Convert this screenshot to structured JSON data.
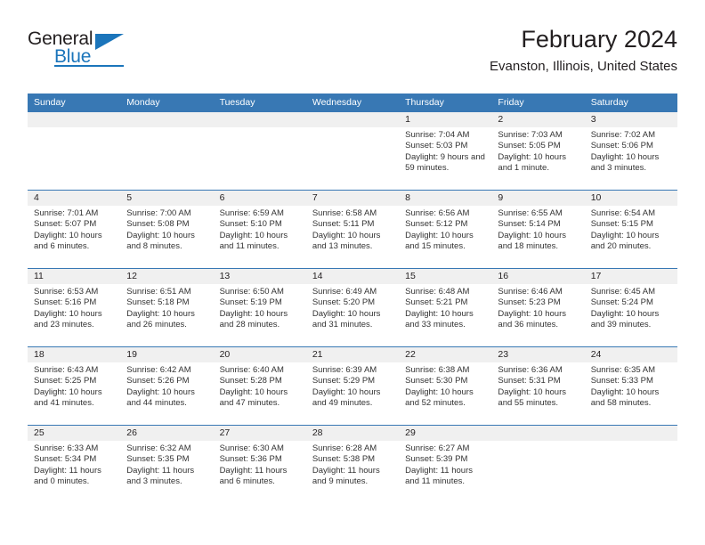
{
  "brand": {
    "name_part1": "General",
    "name_part2": "Blue",
    "logo_icon": "triangle-logo",
    "accent_color": "#1b75bb"
  },
  "header": {
    "title": "February 2024",
    "location": "Evanston, Illinois, United States"
  },
  "calendar": {
    "header_background": "#3878b4",
    "daynum_background": "#f0f0f0",
    "weekday_headers": [
      "Sunday",
      "Monday",
      "Tuesday",
      "Wednesday",
      "Thursday",
      "Friday",
      "Saturday"
    ],
    "weeks": [
      [
        {
          "day": "",
          "sunrise": "",
          "sunset": "",
          "daylight": ""
        },
        {
          "day": "",
          "sunrise": "",
          "sunset": "",
          "daylight": ""
        },
        {
          "day": "",
          "sunrise": "",
          "sunset": "",
          "daylight": ""
        },
        {
          "day": "",
          "sunrise": "",
          "sunset": "",
          "daylight": ""
        },
        {
          "day": "1",
          "sunrise": "Sunrise: 7:04 AM",
          "sunset": "Sunset: 5:03 PM",
          "daylight": "Daylight: 9 hours and 59 minutes."
        },
        {
          "day": "2",
          "sunrise": "Sunrise: 7:03 AM",
          "sunset": "Sunset: 5:05 PM",
          "daylight": "Daylight: 10 hours and 1 minute."
        },
        {
          "day": "3",
          "sunrise": "Sunrise: 7:02 AM",
          "sunset": "Sunset: 5:06 PM",
          "daylight": "Daylight: 10 hours and 3 minutes."
        }
      ],
      [
        {
          "day": "4",
          "sunrise": "Sunrise: 7:01 AM",
          "sunset": "Sunset: 5:07 PM",
          "daylight": "Daylight: 10 hours and 6 minutes."
        },
        {
          "day": "5",
          "sunrise": "Sunrise: 7:00 AM",
          "sunset": "Sunset: 5:08 PM",
          "daylight": "Daylight: 10 hours and 8 minutes."
        },
        {
          "day": "6",
          "sunrise": "Sunrise: 6:59 AM",
          "sunset": "Sunset: 5:10 PM",
          "daylight": "Daylight: 10 hours and 11 minutes."
        },
        {
          "day": "7",
          "sunrise": "Sunrise: 6:58 AM",
          "sunset": "Sunset: 5:11 PM",
          "daylight": "Daylight: 10 hours and 13 minutes."
        },
        {
          "day": "8",
          "sunrise": "Sunrise: 6:56 AM",
          "sunset": "Sunset: 5:12 PM",
          "daylight": "Daylight: 10 hours and 15 minutes."
        },
        {
          "day": "9",
          "sunrise": "Sunrise: 6:55 AM",
          "sunset": "Sunset: 5:14 PM",
          "daylight": "Daylight: 10 hours and 18 minutes."
        },
        {
          "day": "10",
          "sunrise": "Sunrise: 6:54 AM",
          "sunset": "Sunset: 5:15 PM",
          "daylight": "Daylight: 10 hours and 20 minutes."
        }
      ],
      [
        {
          "day": "11",
          "sunrise": "Sunrise: 6:53 AM",
          "sunset": "Sunset: 5:16 PM",
          "daylight": "Daylight: 10 hours and 23 minutes."
        },
        {
          "day": "12",
          "sunrise": "Sunrise: 6:51 AM",
          "sunset": "Sunset: 5:18 PM",
          "daylight": "Daylight: 10 hours and 26 minutes."
        },
        {
          "day": "13",
          "sunrise": "Sunrise: 6:50 AM",
          "sunset": "Sunset: 5:19 PM",
          "daylight": "Daylight: 10 hours and 28 minutes."
        },
        {
          "day": "14",
          "sunrise": "Sunrise: 6:49 AM",
          "sunset": "Sunset: 5:20 PM",
          "daylight": "Daylight: 10 hours and 31 minutes."
        },
        {
          "day": "15",
          "sunrise": "Sunrise: 6:48 AM",
          "sunset": "Sunset: 5:21 PM",
          "daylight": "Daylight: 10 hours and 33 minutes."
        },
        {
          "day": "16",
          "sunrise": "Sunrise: 6:46 AM",
          "sunset": "Sunset: 5:23 PM",
          "daylight": "Daylight: 10 hours and 36 minutes."
        },
        {
          "day": "17",
          "sunrise": "Sunrise: 6:45 AM",
          "sunset": "Sunset: 5:24 PM",
          "daylight": "Daylight: 10 hours and 39 minutes."
        }
      ],
      [
        {
          "day": "18",
          "sunrise": "Sunrise: 6:43 AM",
          "sunset": "Sunset: 5:25 PM",
          "daylight": "Daylight: 10 hours and 41 minutes."
        },
        {
          "day": "19",
          "sunrise": "Sunrise: 6:42 AM",
          "sunset": "Sunset: 5:26 PM",
          "daylight": "Daylight: 10 hours and 44 minutes."
        },
        {
          "day": "20",
          "sunrise": "Sunrise: 6:40 AM",
          "sunset": "Sunset: 5:28 PM",
          "daylight": "Daylight: 10 hours and 47 minutes."
        },
        {
          "day": "21",
          "sunrise": "Sunrise: 6:39 AM",
          "sunset": "Sunset: 5:29 PM",
          "daylight": "Daylight: 10 hours and 49 minutes."
        },
        {
          "day": "22",
          "sunrise": "Sunrise: 6:38 AM",
          "sunset": "Sunset: 5:30 PM",
          "daylight": "Daylight: 10 hours and 52 minutes."
        },
        {
          "day": "23",
          "sunrise": "Sunrise: 6:36 AM",
          "sunset": "Sunset: 5:31 PM",
          "daylight": "Daylight: 10 hours and 55 minutes."
        },
        {
          "day": "24",
          "sunrise": "Sunrise: 6:35 AM",
          "sunset": "Sunset: 5:33 PM",
          "daylight": "Daylight: 10 hours and 58 minutes."
        }
      ],
      [
        {
          "day": "25",
          "sunrise": "Sunrise: 6:33 AM",
          "sunset": "Sunset: 5:34 PM",
          "daylight": "Daylight: 11 hours and 0 minutes."
        },
        {
          "day": "26",
          "sunrise": "Sunrise: 6:32 AM",
          "sunset": "Sunset: 5:35 PM",
          "daylight": "Daylight: 11 hours and 3 minutes."
        },
        {
          "day": "27",
          "sunrise": "Sunrise: 6:30 AM",
          "sunset": "Sunset: 5:36 PM",
          "daylight": "Daylight: 11 hours and 6 minutes."
        },
        {
          "day": "28",
          "sunrise": "Sunrise: 6:28 AM",
          "sunset": "Sunset: 5:38 PM",
          "daylight": "Daylight: 11 hours and 9 minutes."
        },
        {
          "day": "29",
          "sunrise": "Sunrise: 6:27 AM",
          "sunset": "Sunset: 5:39 PM",
          "daylight": "Daylight: 11 hours and 11 minutes."
        },
        {
          "day": "",
          "sunrise": "",
          "sunset": "",
          "daylight": ""
        },
        {
          "day": "",
          "sunrise": "",
          "sunset": "",
          "daylight": ""
        }
      ]
    ]
  }
}
